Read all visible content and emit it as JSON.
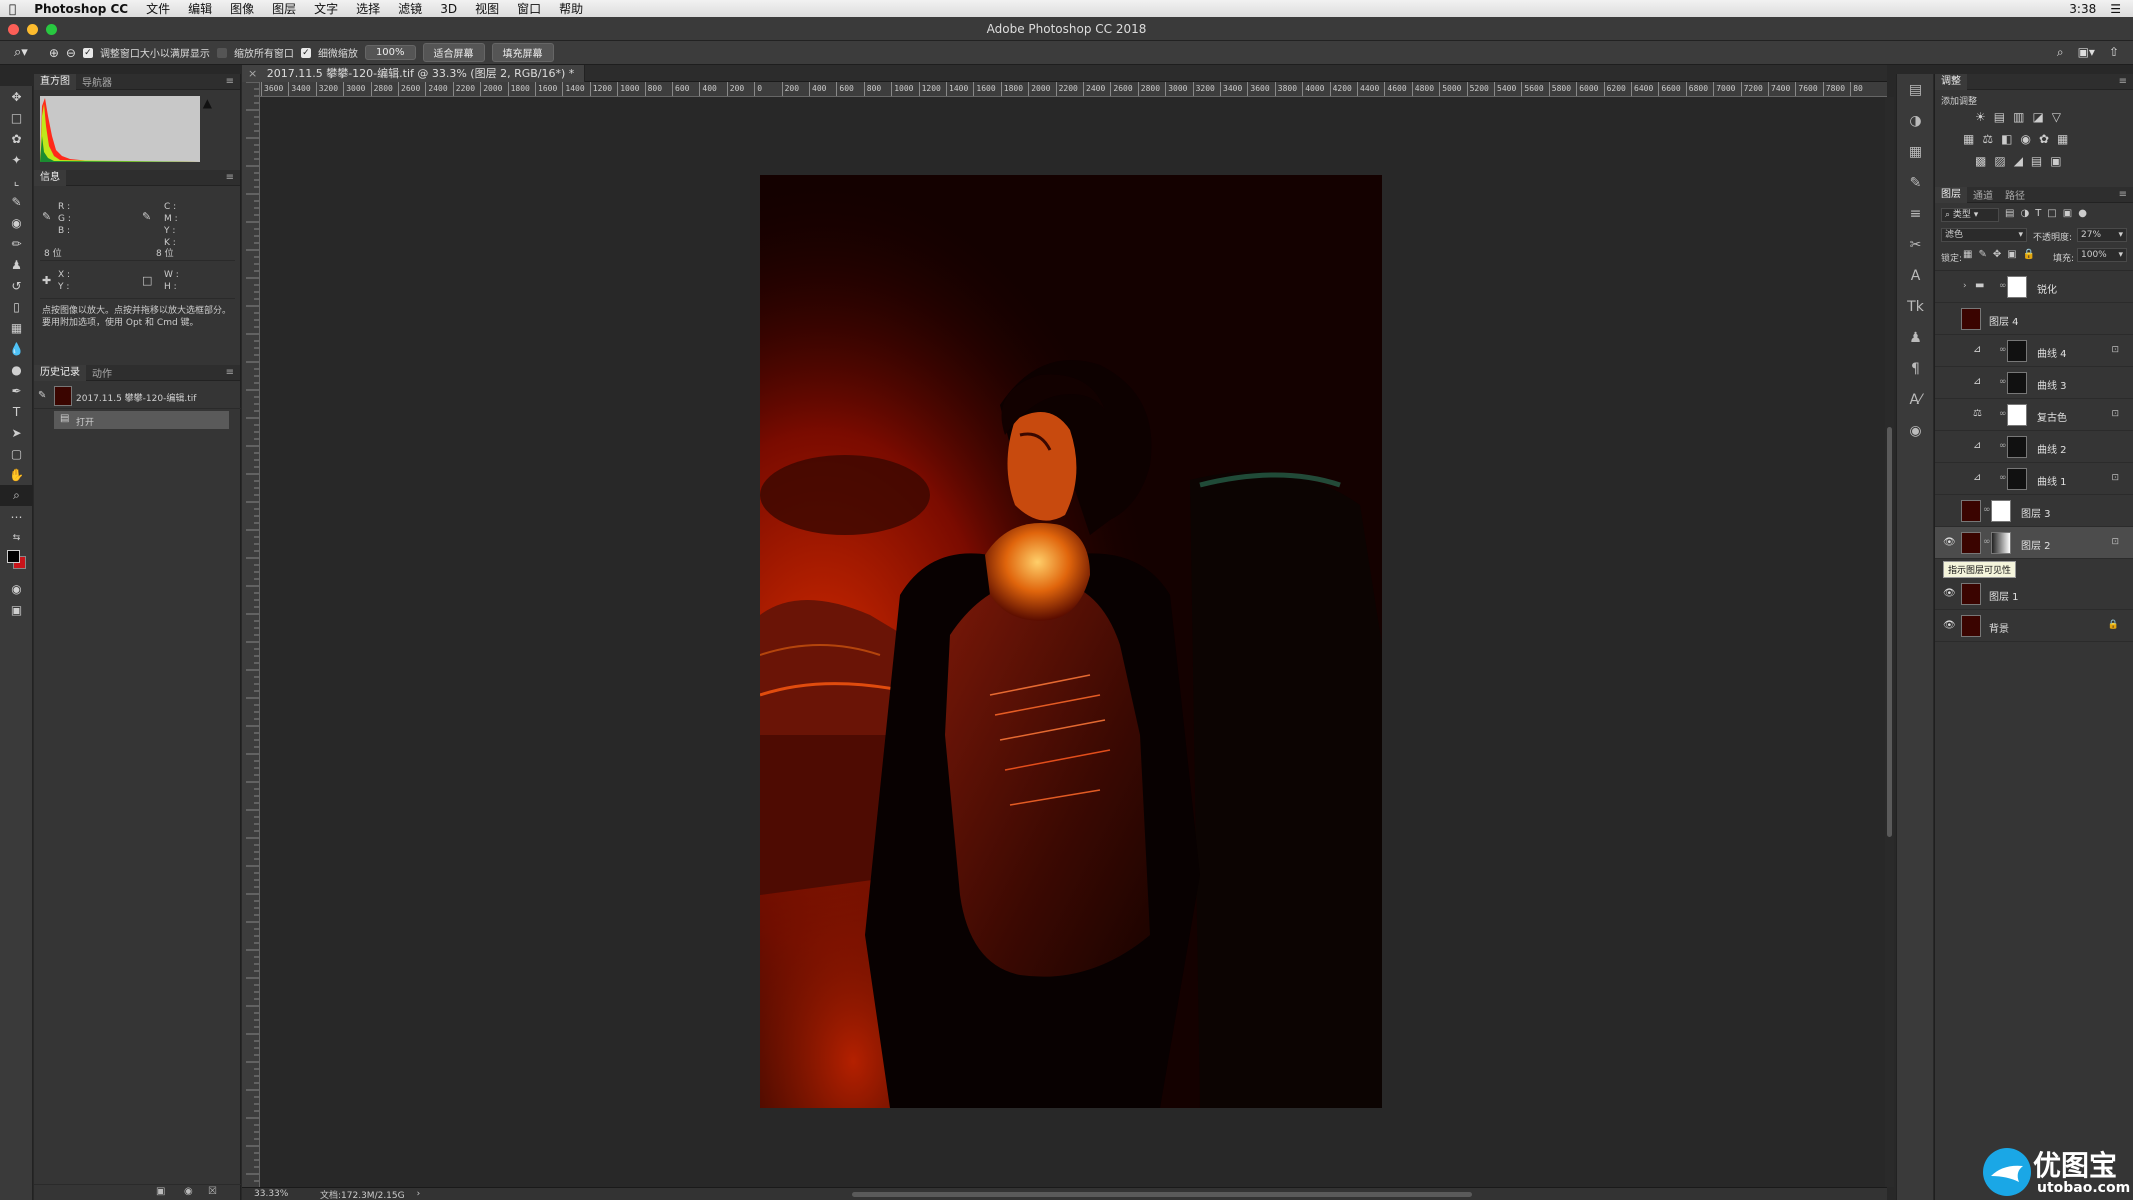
{
  "menubar": {
    "apple": "",
    "app": "Photoshop CC",
    "items": [
      "文件",
      "编辑",
      "图像",
      "图层",
      "文字",
      "选择",
      "滤镜",
      "3D",
      "视图",
      "窗口",
      "帮助"
    ],
    "clock": "3:38"
  },
  "window": {
    "title": "Adobe Photoshop CC 2018"
  },
  "options": {
    "resize_windows_label": "调整窗口大小以满屏显示",
    "zoom_all_label": "缩放所有窗口",
    "scrubby_label": "细微缩放",
    "zoom_value": "100%",
    "fit_screen_label": "适合屏幕",
    "fill_screen_label": "填充屏幕"
  },
  "histogram": {
    "tabs": [
      "直方图",
      "导航器"
    ]
  },
  "info": {
    "tab": "信息",
    "rgb_labels": [
      "R :",
      "G :",
      "B :"
    ],
    "cmyk_labels": [
      "C :",
      "M :",
      "Y :",
      "K :"
    ],
    "bits_left": "8 位",
    "bits_right": "8 位",
    "xy_labels": [
      "X :",
      "Y :"
    ],
    "wh_labels": [
      "W :",
      "H :"
    ],
    "help_text": "点按图像以放大。点按并拖移以放大选框部分。要用附加选项，使用 Opt 和 Cmd 键。"
  },
  "history": {
    "tabs": [
      "历史记录",
      "动作"
    ],
    "snapshot": "2017.11.5 攀攀-120-编辑.tif",
    "steps": [
      "打开"
    ]
  },
  "document": {
    "tab_title": "2017.11.5 攀攀-120-编辑.tif @ 33.3% (图层 2, RGB/16*) *",
    "ruler_labels": [
      "3600",
      "3400",
      "3200",
      "3000",
      "2800",
      "2600",
      "2400",
      "2200",
      "2000",
      "1800",
      "1600",
      "1400",
      "1200",
      "1000",
      "800",
      "600",
      "400",
      "200",
      "0",
      "200",
      "400",
      "600",
      "800",
      "1000",
      "1200",
      "1400",
      "1600",
      "1800",
      "2000",
      "2200",
      "2400",
      "2600",
      "2800",
      "3000",
      "3200",
      "3400",
      "3600",
      "3800",
      "4000",
      "4200",
      "4400",
      "4600",
      "4800",
      "5000",
      "5200",
      "5400",
      "5600",
      "5800",
      "6000",
      "6200",
      "6400",
      "6600",
      "6800",
      "7000",
      "7200",
      "7400",
      "7600",
      "7800",
      "80"
    ],
    "zoom": "33.33%",
    "doc_size": "文档:172.3M/2.15G"
  },
  "adjustments": {
    "tab": "调整",
    "add_label": "添加调整"
  },
  "layers_panel": {
    "tabs": [
      "图层",
      "通道",
      "路径"
    ],
    "filter_kind": "类型",
    "blend_mode": "滤色",
    "opacity_label": "不透明度:",
    "opacity_value": "27%",
    "lock_label": "锁定:",
    "fill_label": "填充:",
    "fill_value": "100%",
    "tooltip": "指示图层可见性",
    "layers": [
      {
        "name": "锐化",
        "type": "group",
        "visible": false
      },
      {
        "name": "图层 4",
        "type": "pixel",
        "visible": false
      },
      {
        "name": "曲线 4",
        "type": "curves",
        "visible": false
      },
      {
        "name": "曲线 3",
        "type": "curves",
        "visible": false
      },
      {
        "name": "复古色",
        "type": "colorbalance",
        "visible": false
      },
      {
        "name": "曲线 2",
        "type": "curves",
        "visible": false
      },
      {
        "name": "曲线 1",
        "type": "curves",
        "visible": false
      },
      {
        "name": "图层 3",
        "type": "pixel",
        "visible": false
      },
      {
        "name": "图层 2",
        "type": "pixel",
        "visible": true,
        "selected": true
      },
      {
        "name": "图层 1",
        "type": "pixel",
        "visible": true
      },
      {
        "name": "背景",
        "type": "background",
        "visible": true,
        "locked": true
      }
    ]
  },
  "watermark": {
    "brand": "优图宝",
    "url": "utobao.com"
  }
}
